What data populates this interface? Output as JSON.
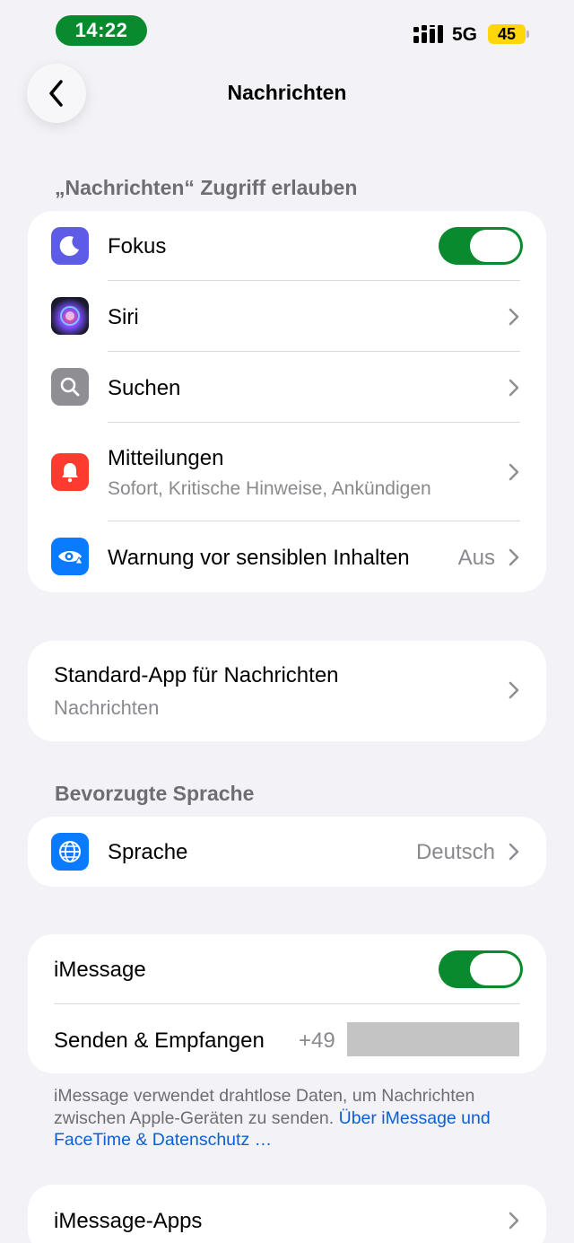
{
  "status_bar": {
    "time": "14:22",
    "network": "5G",
    "battery": "45",
    "colors": {
      "time_pill": "#0a8a2e",
      "battery": "#ffd60a"
    }
  },
  "nav": {
    "title": "Nachrichten",
    "back_icon": "chevron-left-icon"
  },
  "access_section": {
    "header": "„Nachrichten“ Zugriff erlauben",
    "items": [
      {
        "label": "Fokus",
        "icon": "moon-icon",
        "icon_color": "#5e5ce6",
        "toggle": true
      },
      {
        "label": "Siri",
        "icon": "siri-icon",
        "icon_color": "#1c1c2e"
      },
      {
        "label": "Suchen",
        "icon": "search-icon",
        "icon_color": "#8e8e93"
      },
      {
        "label": "Mitteilungen",
        "sublabel": "Sofort, Kritische Hinweise, Ankündigen",
        "icon": "bell-icon",
        "icon_color": "#ff3b30"
      },
      {
        "label": "Warnung vor sensiblen Inhalten",
        "value": "Aus",
        "icon": "eye-warning-icon",
        "icon_color": "#0a7aff"
      }
    ]
  },
  "default_app": {
    "label": "Standard-App für Nachrichten",
    "value": "Nachrichten"
  },
  "language_section": {
    "header": "Bevorzugte Sprache",
    "label": "Sprache",
    "value": "Deutsch",
    "icon": "globe-icon",
    "icon_color": "#0a7aff"
  },
  "imessage": {
    "toggle_label": "iMessage",
    "toggle_on": true,
    "send_receive_label": "Senden & Empfangen",
    "phone_prefix": "+49",
    "footer_text": "iMessage verwendet drahtlose Daten, um Nachrichten zwischen Apple-Geräten zu senden.",
    "footer_link": "Über iMessage und FaceTime & Datenschutz …"
  },
  "imessage_apps": {
    "label": "iMessage-Apps"
  },
  "colors": {
    "background": "#f2f2f7",
    "toggle_on": "#0a8a2e",
    "link": "#0a60d8"
  }
}
